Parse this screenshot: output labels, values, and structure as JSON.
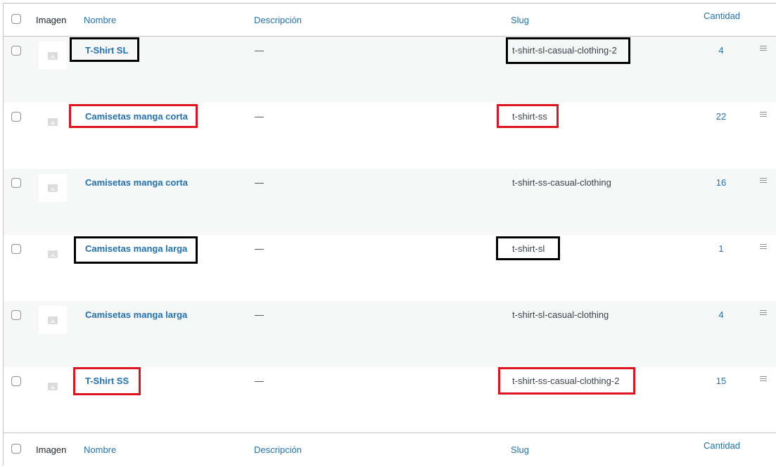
{
  "header": {
    "imagen": "Imagen",
    "nombre": "Nombre",
    "descripcion": "Descripción",
    "slug": "Slug",
    "cantidad": "Cantidad"
  },
  "rows": [
    {
      "name": "T-Shirt SL",
      "description": "—",
      "slug": "t-shirt-sl-casual-clothing-2",
      "count": "4",
      "highlight": "black"
    },
    {
      "name": "Camisetas manga corta",
      "description": "—",
      "slug": "t-shirt-ss",
      "count": "22",
      "highlight": "red"
    },
    {
      "name": "Camisetas manga corta",
      "description": "—",
      "slug": "t-shirt-ss-casual-clothing",
      "count": "16",
      "highlight": "none"
    },
    {
      "name": "Camisetas manga larga",
      "description": "—",
      "slug": "t-shirt-sl",
      "count": "1",
      "highlight": "black"
    },
    {
      "name": "Camisetas manga larga",
      "description": "—",
      "slug": "t-shirt-sl-casual-clothing",
      "count": "4",
      "highlight": "none"
    },
    {
      "name": "T-Shirt SS",
      "description": "—",
      "slug": "t-shirt-ss-casual-clothing-2",
      "count": "15",
      "highlight": "red"
    }
  ],
  "colors": {
    "link": "#2271b1",
    "highlight_black": "#000000",
    "highlight_red": "#e0141e",
    "row_alt": "#f6f7f7"
  },
  "icons": {
    "thumbnail": "image-placeholder-icon",
    "reorder": "drag-handle-icon"
  }
}
